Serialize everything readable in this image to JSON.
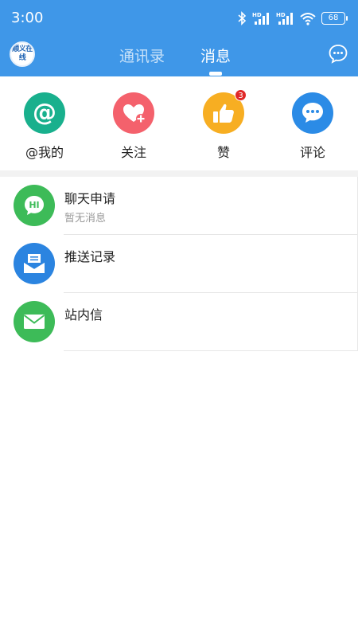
{
  "status_bar": {
    "time": "3:00",
    "battery": "68",
    "icons": [
      "bluetooth-icon",
      "signal-hd-icon",
      "signal-hd-icon",
      "wifi-icon",
      "battery-icon"
    ]
  },
  "nav": {
    "avatar_text": "顺义在线",
    "tabs": [
      {
        "label": "通讯录",
        "active": false
      },
      {
        "label": "消息",
        "active": true
      }
    ],
    "right_icon": "chat-bubble-icon"
  },
  "quick_actions": [
    {
      "label": "@我的",
      "icon": "at-icon",
      "color": "#19b08d"
    },
    {
      "label": "关注",
      "icon": "heart-plus-icon",
      "color": "#f4616c"
    },
    {
      "label": "赞",
      "icon": "thumbs-up-icon",
      "color": "#f7ae22",
      "badge": "3"
    },
    {
      "label": "评论",
      "icon": "comment-icon",
      "color": "#2b8be6"
    }
  ],
  "list": [
    {
      "title": "聊天申请",
      "subtitle": "暂无消息",
      "icon": "hi-chat-icon",
      "color": "#3dbb58"
    },
    {
      "title": "推送记录",
      "subtitle": "",
      "icon": "inbox-icon",
      "color": "#2b84e0"
    },
    {
      "title": "站内信",
      "subtitle": "",
      "icon": "mail-icon",
      "color": "#3dbb58"
    }
  ],
  "colors": {
    "header": "#3f97e8",
    "badge": "#e02828"
  }
}
